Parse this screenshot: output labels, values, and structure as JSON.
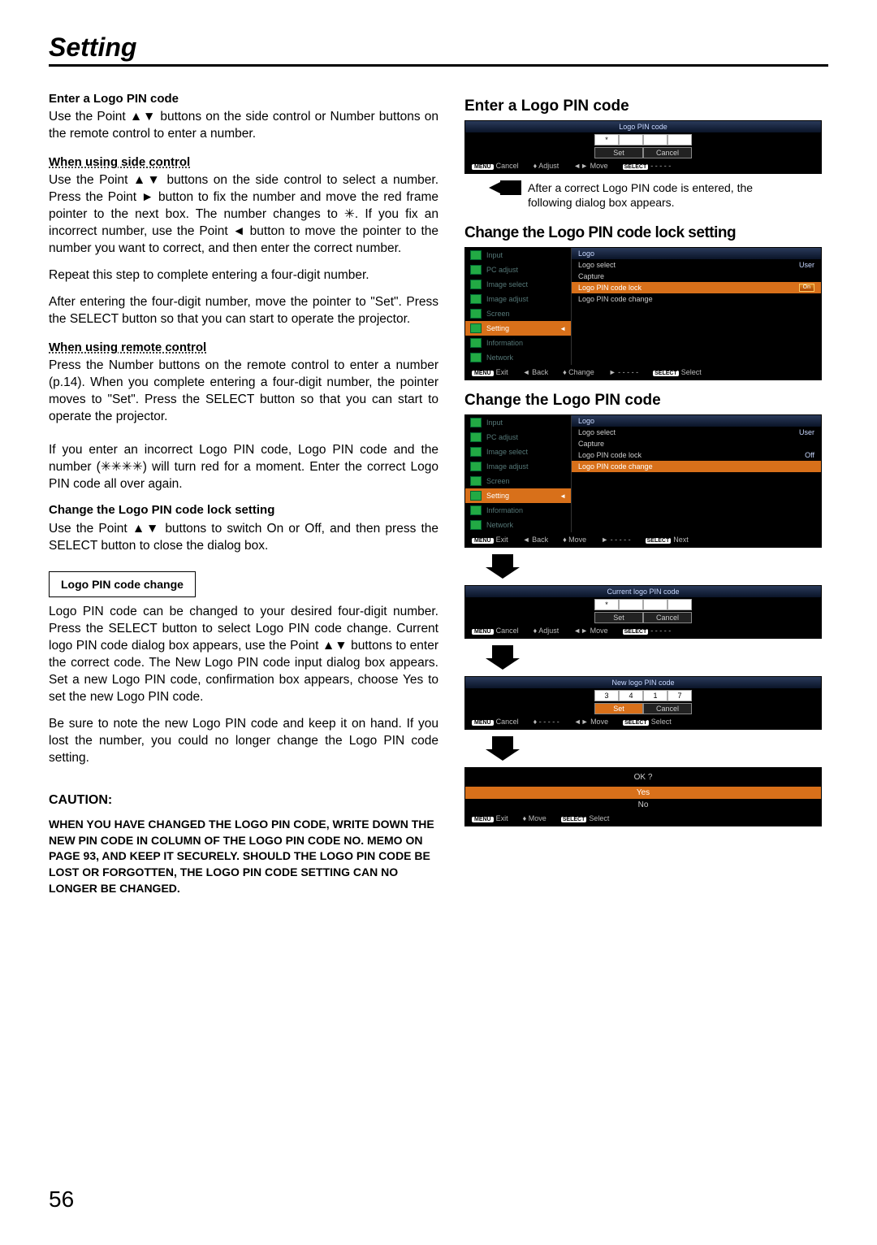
{
  "page_title": "Setting",
  "page_number": "56",
  "left": {
    "h1": "Enter a Logo PIN code",
    "p1": "Use the Point ▲▼ buttons on the side control or Number buttons on the remote control to enter a number.",
    "h2": "When using side control",
    "p2": "Use the Point ▲▼ buttons on the side control to select a number. Press the Point ► button to fix the number and move the red frame pointer to the next box. The number changes to ✳. If you fix an incorrect number, use the Point ◄ button to move the pointer to the number you want to correct, and then enter the correct number.",
    "p3": "Repeat this step to complete entering a four-digit number.",
    "p4": "After entering the four-digit number, move the pointer to \"Set\". Press the SELECT button so that you can start to operate the projector.",
    "h3": "When using remote control",
    "p5": "Press the Number buttons on the remote control to enter a number (p.14). When you complete entering a four-digit number, the pointer moves to \"Set\". Press the SELECT button so that you can start to operate the projector.",
    "p6": "If you enter an incorrect Logo PIN code, Logo PIN code and the number (✳✳✳✳) will turn red for a moment. Enter the correct Logo PIN code all over again.",
    "h4": "Change the Logo PIN code lock setting",
    "p7": "Use the Point ▲▼ buttons to switch On or Off, and then press the SELECT button to close the dialog box.",
    "box_label": "Logo PIN code change",
    "p8": "Logo PIN code can be changed to your desired four-digit number. Press the SELECT button to select Logo PIN code change. Current logo PIN code dialog box appears, use the Point ▲▼ buttons to enter the correct code. The New Logo PIN code input dialog box appears. Set a new Logo PIN code, confirmation box appears, choose Yes to set the new Logo PIN code.",
    "p9": "Be sure to note the new Logo PIN code and keep it on hand. If you lost the number, you could no longer change the Logo PIN code setting.",
    "caution_hd": "CAUTION:",
    "caution_body": "WHEN YOU HAVE CHANGED THE LOGO PIN CODE, WRITE DOWN THE NEW PIN CODE IN COLUMN OF THE LOGO PIN CODE NO. MEMO ON PAGE 93, AND KEEP IT SECURELY. SHOULD THE LOGO PIN CODE BE LOST OR FORGOTTEN, THE LOGO PIN CODE SETTING CAN NO LONGER BE CHANGED."
  },
  "right": {
    "h1": "Enter a Logo PIN code",
    "pin_title1": "Logo PIN code",
    "pin_asterisk": "*",
    "set": "Set",
    "cancel": "Cancel",
    "bb_cancel": "Cancel",
    "bb_adjust": "Adjust",
    "bb_move": "Move",
    "bb_dash": "- - - - -",
    "bb_exit": "Exit",
    "bb_back": "Back",
    "bb_change": "Change",
    "bb_select": "Select",
    "bb_next": "Next",
    "menu_label": "MENU",
    "select_label": "SELECT",
    "note1": "After a correct Logo PIN code is entered, the following dialog box appears.",
    "h2": "Change the Logo PIN code lock setting",
    "h3": "Change the Logo PIN code",
    "menu_items": [
      "Input",
      "PC adjust",
      "Image select",
      "Image adjust",
      "Screen",
      "Setting",
      "Information",
      "Network"
    ],
    "menu_logo_title": "Logo",
    "menu_subs": [
      {
        "l": "Logo select",
        "v": "User"
      },
      {
        "l": "Capture",
        "v": ""
      },
      {
        "l": "Logo PIN code lock",
        "v": "On"
      },
      {
        "l": "Logo PIN code change",
        "v": ""
      }
    ],
    "menu_subs2": [
      {
        "l": "Logo select",
        "v": "User"
      },
      {
        "l": "Capture",
        "v": ""
      },
      {
        "l": "Logo PIN code lock",
        "v": "Off"
      },
      {
        "l": "Logo PIN code change",
        "v": ""
      }
    ],
    "pin_title2": "Current logo PIN code",
    "pin_title3": "New logo PIN code",
    "new_pin_vals": [
      "3",
      "4",
      "1",
      "7"
    ],
    "ok_title": "OK ?",
    "yes": "Yes",
    "no": "No"
  }
}
